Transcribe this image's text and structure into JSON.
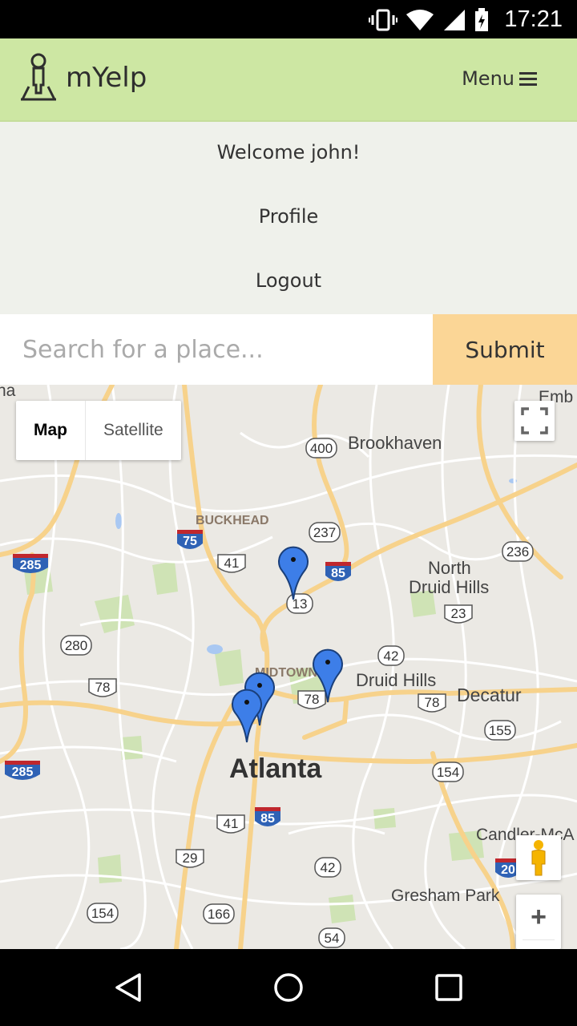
{
  "status_bar": {
    "time": "17:21"
  },
  "navbar": {
    "brand": "mYelp",
    "menu_label": "Menu"
  },
  "dropdown": {
    "welcome": "Welcome john!",
    "profile": "Profile",
    "logout": "Logout"
  },
  "search": {
    "placeholder": "Search for a place...",
    "value": "",
    "submit": "Submit"
  },
  "map": {
    "type_map": "Map",
    "type_satellite": "Satellite",
    "zoom_in": "+",
    "places": {
      "brookhaven": "Brookhaven",
      "buckhead": "BUCKHEAD",
      "north_druid_hills_1": "North",
      "north_druid_hills_2": "Druid Hills",
      "midtown": "MIDTOWN",
      "druid_hills": "Druid Hills",
      "decatur": "Decatur",
      "atlanta": "Atlanta",
      "candler": "Candler-McA",
      "gresham_park": "Gresham Park",
      "emb": "Emb",
      "na": "na"
    },
    "shields": {
      "r400": "400",
      "r237": "237",
      "r236": "236",
      "r13": "13",
      "r23": "23",
      "r42a": "42",
      "r78a": "78",
      "r78b": "78",
      "r78c": "78",
      "r155": "155",
      "r154a": "154",
      "r41a": "41",
      "r41b": "41",
      "r29": "29",
      "r42b": "42",
      "r154b": "154",
      "r166": "166",
      "r54": "54",
      "r280": "280",
      "i75": "75",
      "i85a": "85",
      "i85b": "85",
      "i285a": "285",
      "i285b": "285",
      "i20": "20"
    }
  },
  "colors": {
    "navbar": "#cde7a3",
    "dropdown": "#eff1eb",
    "submit": "#fbd696",
    "marker": "#3d7ee8"
  }
}
